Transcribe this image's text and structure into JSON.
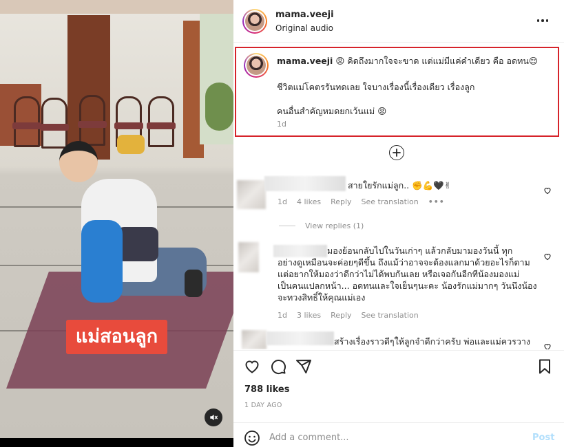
{
  "video": {
    "overlay_caption": "แม่สอนลูก",
    "mute_icon": "muted-speaker-icon"
  },
  "header": {
    "username": "mama.veeji",
    "audio": "Original audio",
    "more_icon": "more-options-icon"
  },
  "caption": {
    "username": "mama.veeji",
    "line1": "😡 คิดถึงมากใจจะขาด แต่แม่มีแค่คำเดียว คือ อดทน😌",
    "line2": "ชีวิตแม่โคตรรันทดเลย ใจบางเรื่องนี้เรื่องเดียว เรื่องลูก",
    "line3": "คนอื่นสำคัญหมดยกเว้นแม่ 😡",
    "time": "1d",
    "highlight_color": "#d6232a"
  },
  "load_more_icon": "plus-circle-icon",
  "comments": [
    {
      "text": "สายใยรักแม่ลูก.. ✊💪🖤✌",
      "time": "1d",
      "likes": "4 likes",
      "reply": "Reply",
      "translate": "See translation",
      "dots": "•••"
    },
    {
      "text_line1": "มองย้อนกลับไปในวันเก่าๆ แล้วกลับมามองวันนี้ ทุก",
      "text_line2": "อย่างดูเหมือนจะค่อยๆดีขึ้น ถึงแม้ว่าอาจจะต้องแลกมาด้วยอะไรก็ตาม",
      "text_line3": "แต่อยากให้มองว่าดีกว่าไม่ได้พบกันเลย หรือเจอกันอีกทีน้องมองแม่",
      "text_line4": "เป็นคนแปลกหน้า... อดทนและใจเย็นๆนะคะ น้องรักแม่มากๆ วันนึงน้อง",
      "text_line5": "จะทวงสิทธิ์ให้คุณแม่เอง",
      "time": "1d",
      "likes": "3 likes",
      "reply": "Reply",
      "translate": "See translation"
    },
    {
      "text": "สร้างเรื่องราวดีๆให้ลูกจำดีกว่าครับ พ่อและแม่ควรวาง"
    }
  ],
  "view_replies": "View replies (1)",
  "actions": {
    "like_icon": "heart-icon",
    "comment_icon": "comment-icon",
    "share_icon": "share-icon",
    "save_icon": "bookmark-icon"
  },
  "likes": "788 likes",
  "post_date": "1 DAY AGO",
  "add_comment": {
    "emoji_icon": "emoji-icon",
    "placeholder": "Add a comment...",
    "post_label": "Post"
  }
}
